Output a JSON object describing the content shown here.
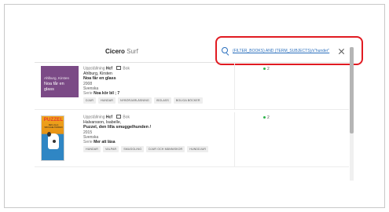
{
  "header": {
    "brand_part1": "Cicero",
    "brand_part2": "Surf"
  },
  "search": {
    "value": "(FILTER_BOOKS) AND (TERM_SUBJECTS)/s\"hunder\""
  },
  "results": [
    {
      "cover": {
        "author": "Ahlburg, Kirsten",
        "title": "Noa får en glass",
        "color": "#7b4a86"
      },
      "status_label": "Uppställning",
      "shelf": "Hcf",
      "format_label": "Bok",
      "author": "Ahlburg, Kirsten",
      "title": "Noa får en glass",
      "year": "2008",
      "language": "Svenska",
      "series_label": "Serie",
      "series": "Noa kör bil ; 7",
      "tags": [
        "DJUR",
        "HUNDAR",
        "NYBÖRJARLÄSNING",
        "ISGLASS",
        "BOLIGA BÖCKER"
      ],
      "count": "2"
    },
    {
      "cover": {
        "head": "PUZZEL",
        "sub": "DEN LILLA SMUGGELHUNDEN"
      },
      "status_label": "Uppställning",
      "shelf": "Hcf",
      "format_label": "Bok",
      "author": "Halvarsson, Isabelle,",
      "title": "Puzzel, den lilla smuggelhunden /",
      "year": "2015",
      "language": "Svenska",
      "series_label": "Serie",
      "series": "Mer att läsa",
      "tags": [
        "HUNDAR",
        "VALPAR",
        "SMUGGLING",
        "DJUR OCH MÄNNISKOR",
        "HUNDDJUR"
      ],
      "count": "2"
    }
  ],
  "colors": {
    "accent": "#2a6fbd",
    "highlight": "#e11b22",
    "available": "#2db34a"
  }
}
